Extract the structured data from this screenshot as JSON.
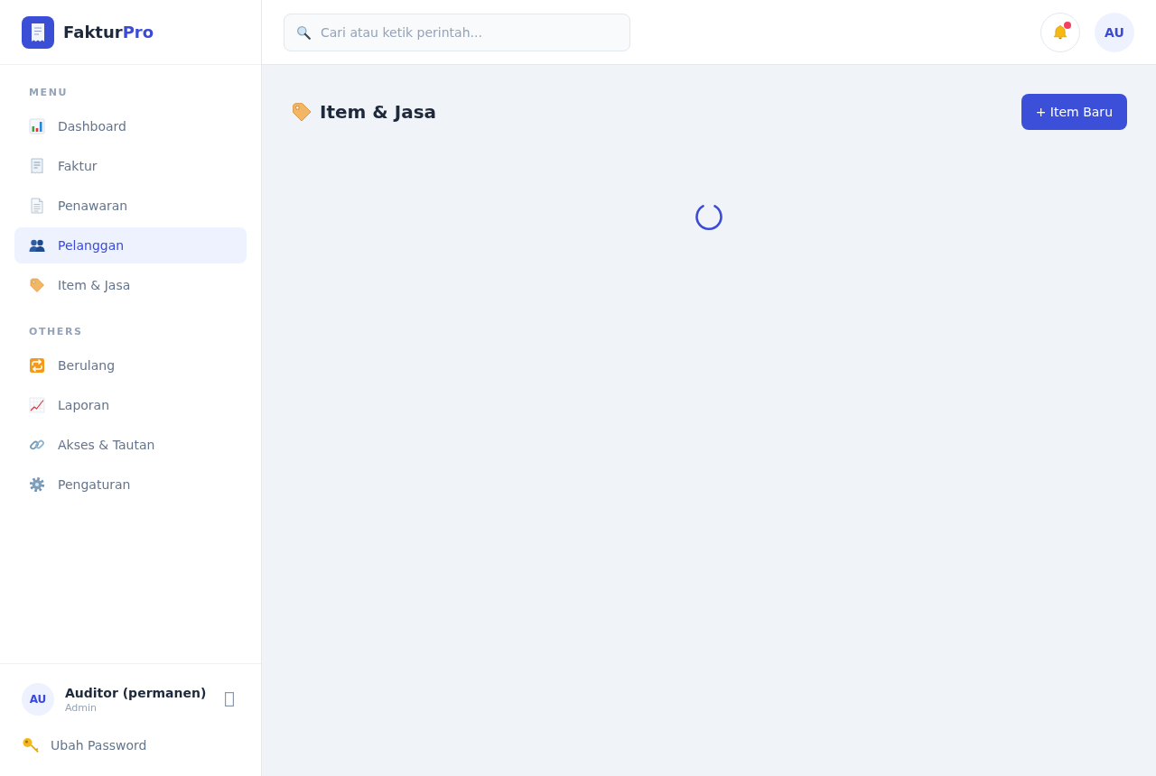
{
  "sidebar": {
    "logo": {
      "name": "Faktur",
      "accent": "Pro"
    },
    "sections": [
      {
        "label": "MENU",
        "items": [
          {
            "label": "Dashboard",
            "selected": false
          },
          {
            "label": "Faktur",
            "selected": false
          },
          {
            "label": "Penawaran",
            "selected": false
          },
          {
            "label": "Pelanggan",
            "selected": true
          },
          {
            "label": "Item & Jasa",
            "selected": false
          }
        ]
      },
      {
        "label": "OTHERS",
        "items": [
          {
            "label": "Berulang",
            "selected": false
          },
          {
            "label": "Laporan",
            "selected": false
          },
          {
            "label": "Akses & Tautan",
            "selected": false
          },
          {
            "label": "Pengaturan",
            "selected": false
          }
        ]
      }
    ],
    "user": {
      "avatar": "AU",
      "name": "Auditor (permanen)",
      "role": "Admin"
    },
    "password_link": "Ubah Password"
  },
  "header": {
    "search": {
      "placeholder": "Cari atau ketik perintah..."
    },
    "notifications": {
      "unread": true
    },
    "avatar": "AU"
  },
  "page": {
    "title": "Item & Jasa",
    "new_button": "+ Item Baru",
    "loading": true
  }
}
